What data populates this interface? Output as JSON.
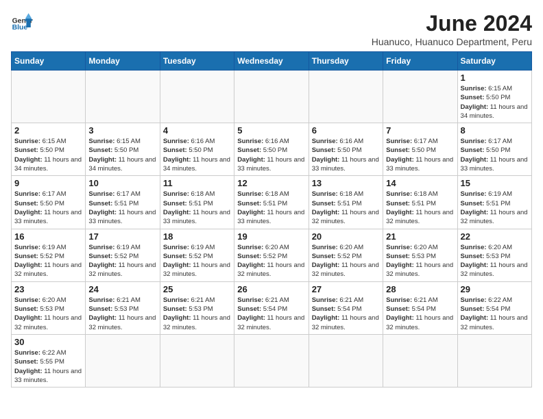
{
  "header": {
    "logo_general": "General",
    "logo_blue": "Blue",
    "month_title": "June 2024",
    "subtitle": "Huanuco, Huanuco Department, Peru"
  },
  "days_of_week": [
    "Sunday",
    "Monday",
    "Tuesday",
    "Wednesday",
    "Thursday",
    "Friday",
    "Saturday"
  ],
  "weeks": [
    [
      {
        "day": "",
        "empty": true
      },
      {
        "day": "",
        "empty": true
      },
      {
        "day": "",
        "empty": true
      },
      {
        "day": "",
        "empty": true
      },
      {
        "day": "",
        "empty": true
      },
      {
        "day": "",
        "empty": true
      },
      {
        "day": "1",
        "sunrise": "6:15 AM",
        "sunset": "5:50 PM",
        "daylight": "11 hours and 34 minutes."
      }
    ],
    [
      {
        "day": "2",
        "sunrise": "6:15 AM",
        "sunset": "5:50 PM",
        "daylight": "11 hours and 34 minutes."
      },
      {
        "day": "3",
        "sunrise": "6:15 AM",
        "sunset": "5:50 PM",
        "daylight": "11 hours and 34 minutes."
      },
      {
        "day": "4",
        "sunrise": "6:16 AM",
        "sunset": "5:50 PM",
        "daylight": "11 hours and 34 minutes."
      },
      {
        "day": "5",
        "sunrise": "6:16 AM",
        "sunset": "5:50 PM",
        "daylight": "11 hours and 33 minutes."
      },
      {
        "day": "6",
        "sunrise": "6:16 AM",
        "sunset": "5:50 PM",
        "daylight": "11 hours and 33 minutes."
      },
      {
        "day": "7",
        "sunrise": "6:17 AM",
        "sunset": "5:50 PM",
        "daylight": "11 hours and 33 minutes."
      },
      {
        "day": "8",
        "sunrise": "6:17 AM",
        "sunset": "5:50 PM",
        "daylight": "11 hours and 33 minutes."
      }
    ],
    [
      {
        "day": "9",
        "sunrise": "6:17 AM",
        "sunset": "5:50 PM",
        "daylight": "11 hours and 33 minutes."
      },
      {
        "day": "10",
        "sunrise": "6:17 AM",
        "sunset": "5:51 PM",
        "daylight": "11 hours and 33 minutes."
      },
      {
        "day": "11",
        "sunrise": "6:18 AM",
        "sunset": "5:51 PM",
        "daylight": "11 hours and 33 minutes."
      },
      {
        "day": "12",
        "sunrise": "6:18 AM",
        "sunset": "5:51 PM",
        "daylight": "11 hours and 33 minutes."
      },
      {
        "day": "13",
        "sunrise": "6:18 AM",
        "sunset": "5:51 PM",
        "daylight": "11 hours and 32 minutes."
      },
      {
        "day": "14",
        "sunrise": "6:18 AM",
        "sunset": "5:51 PM",
        "daylight": "11 hours and 32 minutes."
      },
      {
        "day": "15",
        "sunrise": "6:19 AM",
        "sunset": "5:51 PM",
        "daylight": "11 hours and 32 minutes."
      }
    ],
    [
      {
        "day": "16",
        "sunrise": "6:19 AM",
        "sunset": "5:52 PM",
        "daylight": "11 hours and 32 minutes."
      },
      {
        "day": "17",
        "sunrise": "6:19 AM",
        "sunset": "5:52 PM",
        "daylight": "11 hours and 32 minutes."
      },
      {
        "day": "18",
        "sunrise": "6:19 AM",
        "sunset": "5:52 PM",
        "daylight": "11 hours and 32 minutes."
      },
      {
        "day": "19",
        "sunrise": "6:20 AM",
        "sunset": "5:52 PM",
        "daylight": "11 hours and 32 minutes."
      },
      {
        "day": "20",
        "sunrise": "6:20 AM",
        "sunset": "5:52 PM",
        "daylight": "11 hours and 32 minutes."
      },
      {
        "day": "21",
        "sunrise": "6:20 AM",
        "sunset": "5:53 PM",
        "daylight": "11 hours and 32 minutes."
      },
      {
        "day": "22",
        "sunrise": "6:20 AM",
        "sunset": "5:53 PM",
        "daylight": "11 hours and 32 minutes."
      }
    ],
    [
      {
        "day": "23",
        "sunrise": "6:20 AM",
        "sunset": "5:53 PM",
        "daylight": "11 hours and 32 minutes."
      },
      {
        "day": "24",
        "sunrise": "6:21 AM",
        "sunset": "5:53 PM",
        "daylight": "11 hours and 32 minutes."
      },
      {
        "day": "25",
        "sunrise": "6:21 AM",
        "sunset": "5:53 PM",
        "daylight": "11 hours and 32 minutes."
      },
      {
        "day": "26",
        "sunrise": "6:21 AM",
        "sunset": "5:54 PM",
        "daylight": "11 hours and 32 minutes."
      },
      {
        "day": "27",
        "sunrise": "6:21 AM",
        "sunset": "5:54 PM",
        "daylight": "11 hours and 32 minutes."
      },
      {
        "day": "28",
        "sunrise": "6:21 AM",
        "sunset": "5:54 PM",
        "daylight": "11 hours and 32 minutes."
      },
      {
        "day": "29",
        "sunrise": "6:22 AM",
        "sunset": "5:54 PM",
        "daylight": "11 hours and 32 minutes."
      }
    ],
    [
      {
        "day": "30",
        "sunrise": "6:22 AM",
        "sunset": "5:55 PM",
        "daylight": "11 hours and 33 minutes."
      },
      {
        "day": "",
        "empty": true
      },
      {
        "day": "",
        "empty": true
      },
      {
        "day": "",
        "empty": true
      },
      {
        "day": "",
        "empty": true
      },
      {
        "day": "",
        "empty": true
      },
      {
        "day": "",
        "empty": true
      }
    ]
  ],
  "labels": {
    "sunrise": "Sunrise:",
    "sunset": "Sunset:",
    "daylight": "Daylight:"
  }
}
